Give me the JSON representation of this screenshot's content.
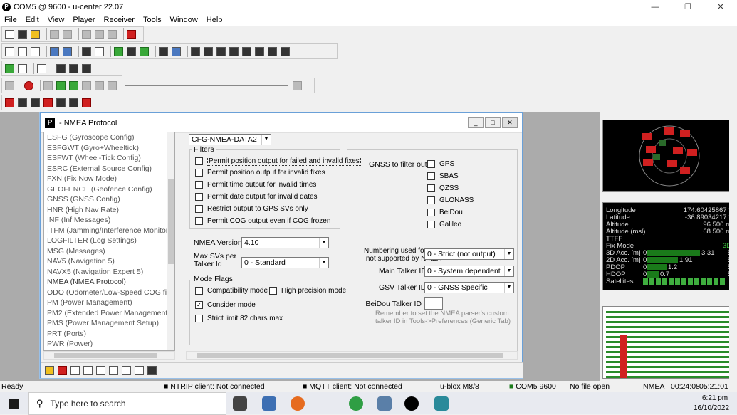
{
  "window": {
    "title": "COM5 @ 9600 - u-center 22.07",
    "app_icon": "P"
  },
  "menu": [
    "File",
    "Edit",
    "View",
    "Player",
    "Receiver",
    "Tools",
    "Window",
    "Help"
  ],
  "dialog": {
    "title": "- NMEA Protocol",
    "icon": "P",
    "message_list": [
      "ESFG (Gyroscope Config)",
      "ESFGWT (Gyro+Wheeltick)",
      "ESFWT (Wheel-Tick Config)",
      "ESRC (External Source Config)",
      "FXN (Fix Now Mode)",
      "GEOFENCE (Geofence Config)",
      "GNSS (GNSS Config)",
      "HNR (High Nav Rate)",
      "INF (Inf Messages)",
      "ITFM (Jamming/Interference Monitor)",
      "LOGFILTER (Log Settings)",
      "MSG (Messages)",
      "NAV5 (Navigation 5)",
      "NAVX5 (Navigation Expert 5)",
      "NMEA (NMEA Protocol)",
      "ODO (Odometer/Low-Speed COG filter)",
      "PM (Power Management)",
      "PM2 (Extended Power Management)",
      "PMS (Power Management Setup)",
      "PRT (Ports)",
      "PWR (Power)"
    ],
    "selected_message": "NMEA (NMEA Protocol)",
    "config_select": "CFG-NMEA-DATA2",
    "filters": {
      "label": "Filters",
      "items": [
        {
          "label": "Permit position output for failed and invalid fixes",
          "checked": false
        },
        {
          "label": "Permit position output for invalid fixes",
          "checked": false
        },
        {
          "label": "Permit time output for invalid times",
          "checked": false
        },
        {
          "label": "Permit date output for invalid dates",
          "checked": false
        },
        {
          "label": "Restrict output to GPS SVs only",
          "checked": false
        },
        {
          "label": "Permit COG output even if COG frozen",
          "checked": false
        }
      ]
    },
    "nmea_version": {
      "label": "NMEA Version",
      "value": "4.10"
    },
    "max_svs": {
      "label": "Max SVs per\nTalker Id",
      "value": "0 - Standard"
    },
    "mode_flags": {
      "label": "Mode Flags",
      "compat": {
        "label": "Compatibility mode",
        "checked": false
      },
      "high_precision": {
        "label": "High precision mode",
        "checked": false
      },
      "consider": {
        "label": "Consider mode",
        "checked": true
      },
      "strict": {
        "label": "Strict limit 82 chars max",
        "checked": false
      }
    },
    "gnss_filter": {
      "label": "GNSS to filter out:",
      "items": [
        {
          "label": "GPS",
          "checked": false
        },
        {
          "label": "SBAS",
          "checked": false
        },
        {
          "label": "QZSS",
          "checked": false
        },
        {
          "label": "GLONASS",
          "checked": false
        },
        {
          "label": "BeiDou",
          "checked": false
        },
        {
          "label": "Galileo",
          "checked": false
        }
      ]
    },
    "numbering": {
      "label": "Numbering used for SVs\nnot supported by NMEA",
      "value": "0 - Strict (not output)"
    },
    "main_talker": {
      "label": "Main Talker ID",
      "value": "0 - System dependent"
    },
    "gsv_talker": {
      "label": "GSV Talker ID",
      "value": "0 - GNSS Specific"
    },
    "beidou_talker": {
      "label": "BeiDou Talker ID",
      "value": ""
    },
    "hint": "Remember to set the NMEA parser's custom talker ID in Tools->Preferences (Generic Tab)"
  },
  "nav_panel": {
    "rows": [
      {
        "label": "Longitude",
        "value": "174.60425867 °"
      },
      {
        "label": "Latitude",
        "value": "-36.89034217 °"
      },
      {
        "label": "Altitude",
        "value": "96.500 m"
      },
      {
        "label": "Altitude (msl)",
        "value": "68.500 m"
      },
      {
        "label": "TTFF",
        "value": ""
      },
      {
        "label": "Fix Mode",
        "value": "3D"
      }
    ],
    "bars": [
      {
        "label": "3D Acc. [m]",
        "min": "0",
        "max": "5",
        "value": 3.31,
        "text": "3.31"
      },
      {
        "label": "2D Acc. [m]",
        "min": "0",
        "max": "5",
        "value": 1.91,
        "text": "1.91"
      },
      {
        "label": "PDOP",
        "min": "0",
        "max": "5",
        "value": 1.2,
        "text": "1.2"
      },
      {
        "label": "HDOP",
        "min": "0",
        "max": "5",
        "value": 0.7,
        "text": "0.7"
      }
    ],
    "satellites_label": "Satellites"
  },
  "status_bar": {
    "ready": "Ready",
    "ntrip": "NTRIP client: Not connected",
    "mqtt": "MQTT client: Not connected",
    "receiver": "u-blox M8/8",
    "port": "COM5 9600",
    "file": "No file open",
    "protocol": "NMEA",
    "elapsed": "00:24:08",
    "clock": "05:21:01"
  },
  "taskbar": {
    "search_placeholder": "Type here to search",
    "time": "6:21 pm",
    "date": "16/10/2022"
  },
  "colors": {
    "accent": "#6aa0d8",
    "fix_green": "#1a7a1a",
    "sky_red": "#d02020"
  }
}
